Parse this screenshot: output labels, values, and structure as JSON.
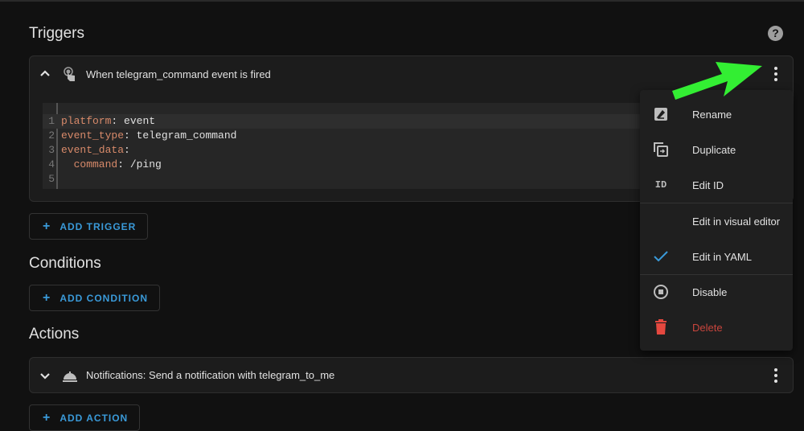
{
  "sections": {
    "triggers": "Triggers",
    "conditions": "Conditions",
    "actions": "Actions"
  },
  "help_icon": "?",
  "trigger": {
    "title": "When telegram_command event is fired",
    "icon": "gesture-tap-icon",
    "code_lines": [
      {
        "num": "1",
        "key": "platform",
        "value": " event"
      },
      {
        "num": "2",
        "key": "event_type",
        "value": " telegram_command"
      },
      {
        "num": "3",
        "key": "event_data",
        "value": ""
      },
      {
        "num": "4",
        "key": "  command",
        "value": " /ping"
      },
      {
        "num": "5",
        "key": "",
        "value": ""
      }
    ]
  },
  "buttons": {
    "add_trigger": "ADD TRIGGER",
    "add_condition": "ADD CONDITION",
    "add_action": "ADD ACTION",
    "plus": "+"
  },
  "action": {
    "title": "Notifications: Send a notification with telegram_to_me",
    "icon": "bell-icon"
  },
  "menu": {
    "items": [
      {
        "label": "Rename",
        "icon": "rename-icon"
      },
      {
        "label": "Duplicate",
        "icon": "duplicate-icon"
      },
      {
        "label": "Edit ID",
        "icon": "id-icon",
        "icon_text": "ID"
      },
      {
        "label": "Edit in visual editor",
        "icon": ""
      },
      {
        "label": "Edit in YAML",
        "icon": "check-icon",
        "checked": true
      },
      {
        "label": "Disable",
        "icon": "disable-icon"
      },
      {
        "label": "Delete",
        "icon": "delete-icon"
      }
    ]
  },
  "colors": {
    "accent": "#3a9ad9",
    "delete": "#e5483f",
    "arrow": "#33ee33",
    "yaml_key": "#d88a6a"
  }
}
